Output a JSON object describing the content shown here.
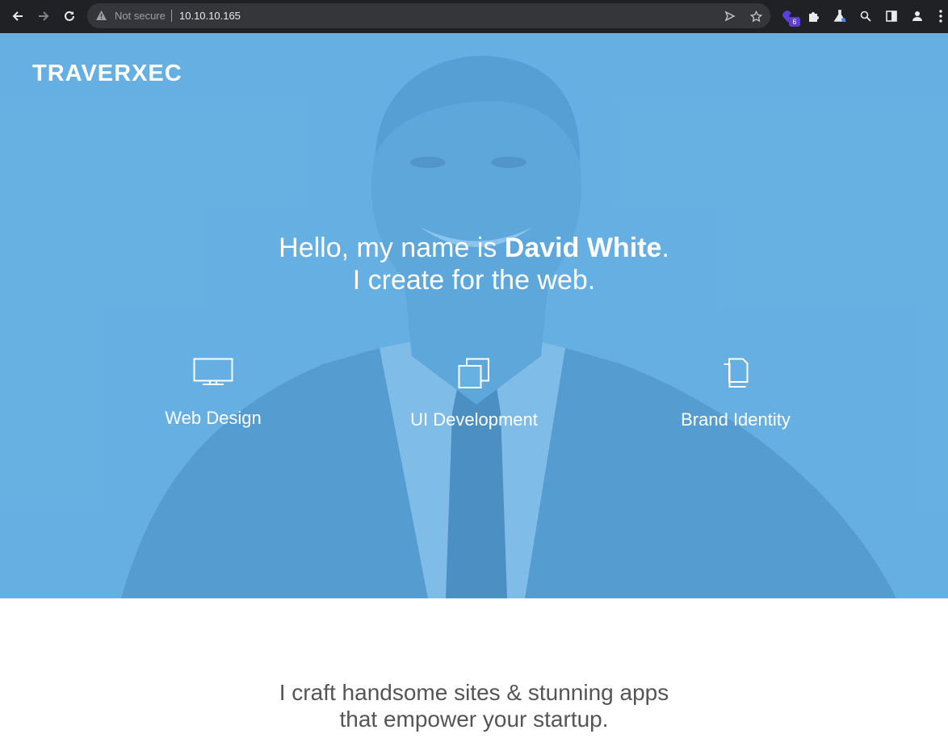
{
  "browser": {
    "security_label": "Not secure",
    "url": "10.10.10.165",
    "extension_badge": "6",
    "icons": [
      "back-arrow-icon",
      "forward-arrow-icon",
      "reload-icon",
      "warning-icon",
      "send-icon",
      "star-icon",
      "extension-purple-icon",
      "puzzle-icon",
      "lab-flask-icon",
      "search-icon",
      "sidepanel-icon",
      "profile-icon",
      "kebab-menu-icon"
    ]
  },
  "hero": {
    "logo": "TRAVERXEC",
    "greeting_pre": "Hello, my name is ",
    "name": "David White",
    "greeting_post": ".",
    "subtitle": "I create for the web.",
    "overlay_color": "#66b0e2",
    "services": [
      {
        "label": "Web Design",
        "icon": "monitor-icon"
      },
      {
        "label": "UI Development",
        "icon": "stacked-windows-icon"
      },
      {
        "label": "Brand Identity",
        "icon": "documents-icon"
      }
    ]
  },
  "about": {
    "line1": "I craft handsome sites & stunning apps",
    "line2": "that empower your startup."
  }
}
